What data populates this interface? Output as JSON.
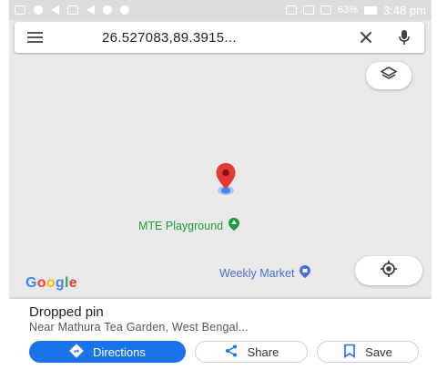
{
  "status_bar": {
    "battery": "63%",
    "time": "3:48 pm"
  },
  "search": {
    "query": "26.527083,89.3915..."
  },
  "map": {
    "pois": [
      {
        "label": "MTE Playground",
        "color": "#1e9b3e",
        "icon": "park-pin-icon"
      },
      {
        "label": "Weekly Market",
        "color": "#4a6fd8",
        "icon": "shopping-pin-icon"
      }
    ],
    "logo": "Google",
    "pin_color": "#e53935"
  },
  "place": {
    "title": "Dropped pin",
    "subtitle": "Near Mathura Tea Garden, West Bengal..."
  },
  "actions": {
    "directions": "Directions",
    "share": "Share",
    "save": "Save"
  },
  "colors": {
    "accent": "#1a73e8",
    "map_background": "#e9e9e9"
  }
}
